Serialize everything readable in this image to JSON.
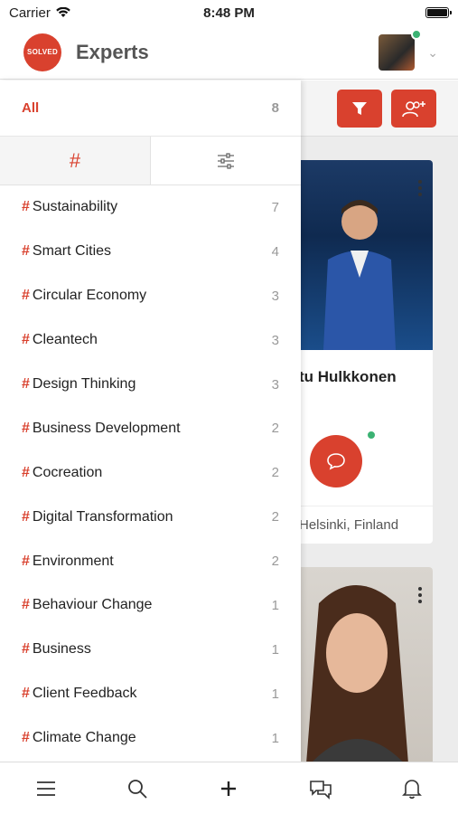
{
  "status_bar": {
    "carrier": "Carrier",
    "time": "8:48 PM"
  },
  "header": {
    "logo_text": "SOLVED",
    "title": "Experts"
  },
  "filter_panel": {
    "all": {
      "label": "All",
      "count": "8"
    },
    "tabs": {
      "hash_label": "#"
    },
    "tags": [
      {
        "label": "Sustainability",
        "count": "7"
      },
      {
        "label": "Smart Cities",
        "count": "4"
      },
      {
        "label": "Circular Economy",
        "count": "3"
      },
      {
        "label": "Cleantech",
        "count": "3"
      },
      {
        "label": "Design Thinking",
        "count": "3"
      },
      {
        "label": "Business Development",
        "count": "2"
      },
      {
        "label": "Cocreation",
        "count": "2"
      },
      {
        "label": "Digital Transformation",
        "count": "2"
      },
      {
        "label": "Environment",
        "count": "2"
      },
      {
        "label": "Behaviour Change",
        "count": "1"
      },
      {
        "label": "Business",
        "count": "1"
      },
      {
        "label": "Client Feedback",
        "count": "1"
      },
      {
        "label": "Climate Change",
        "count": "1"
      }
    ]
  },
  "cards": [
    {
      "name": "tu Hulkkonen",
      "location": "Helsinki, Finland"
    },
    {
      "name": "",
      "location": ""
    }
  ],
  "colors": {
    "accent": "#d9412e",
    "online": "#3bb273"
  },
  "tabbar": {
    "icons": [
      "menu-icon",
      "search-icon",
      "plus-icon",
      "chat-icon",
      "bell-icon"
    ]
  }
}
